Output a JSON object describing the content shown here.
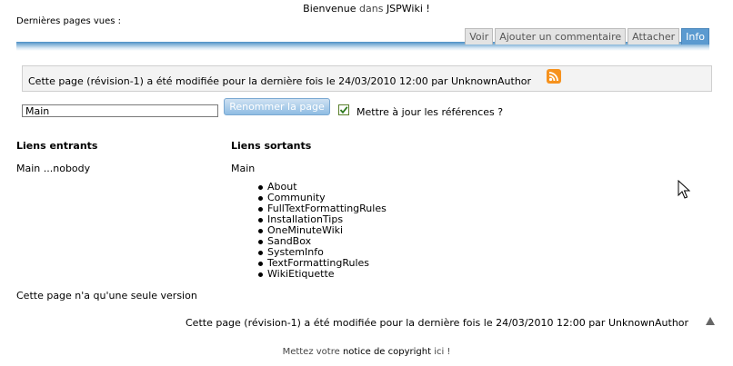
{
  "header": {
    "welcome_prefix": "Bienvenue",
    "welcome_middle": "dans",
    "welcome_site": "JSPWiki !",
    "recent_pages": "Dernières pages vues :"
  },
  "tabs": [
    {
      "label": "Voir"
    },
    {
      "label": "Ajouter un commentaire"
    },
    {
      "label": "Attacher"
    },
    {
      "label": "Info",
      "active": true
    }
  ],
  "info": {
    "modified_text": "Cette page (révision-1) a été modifiée pour la dernière fois le 24/03/2010 12:00 par UnknownAuthor",
    "rss_icon": "rss-feed-icon"
  },
  "rename": {
    "input_value": "Main",
    "button_label": "Renommer la page",
    "checkbox_checked": true,
    "checkbox_label": "Mettre à jour les références ?"
  },
  "links": {
    "incoming_heading": "Liens entrants",
    "outgoing_heading": "Liens sortants",
    "incoming_item": "Main ...nobody",
    "outgoing_root": "Main",
    "outgoing_items": [
      "About",
      "Community",
      "FullTextFormattingRules",
      "InstallationTips",
      "OneMinuteWiki",
      "SandBox",
      "SystemInfo",
      "TextFormattingRules",
      "WikiEtiquette"
    ]
  },
  "versions": {
    "single_version": "Cette page n'a qu'une seule version"
  },
  "footer": {
    "modified_text": "Cette page (révision-1) a été modifiée pour la dernière fois le 24/03/2010 12:00 par UnknownAuthor",
    "copyright_prefix": "Mettez votre",
    "copyright_link": "notice de copyright",
    "copyright_suffix": "ici !"
  },
  "colors": {
    "accent": "#5b9ad0",
    "rss": "#f6921e"
  }
}
